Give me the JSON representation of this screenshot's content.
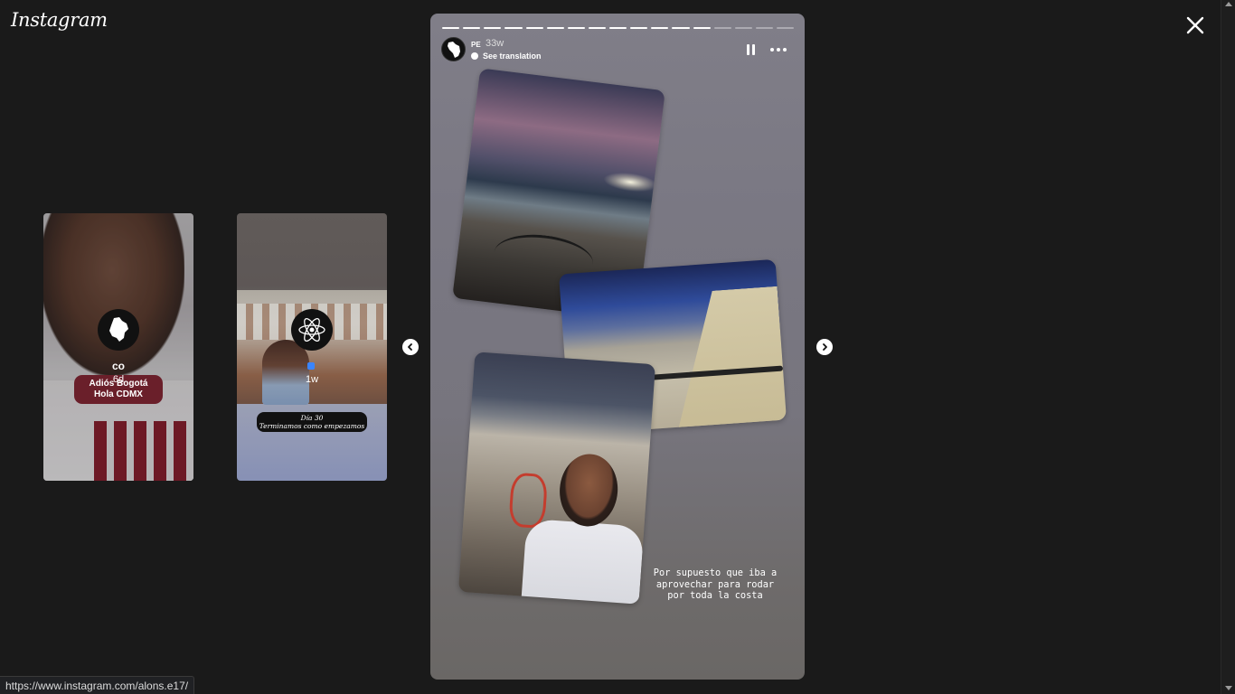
{
  "brand": {
    "logo_text": "Instagram"
  },
  "controls": {
    "close_icon": "close-icon",
    "prev_icon": "chevron-left-icon",
    "next_icon": "chevron-right-icon"
  },
  "previews": [
    {
      "user": "co",
      "time": "6d",
      "sticker_line1": "Adiós Bogotá",
      "sticker_line2": "Hola CDMX",
      "avatar_icon": "colombia-map-icon"
    },
    {
      "user": "",
      "time": "1w",
      "caption_line1": "Día 30",
      "caption_line2": "Terminamos como empezamos",
      "avatar_icon": "atom-icon"
    }
  ],
  "story": {
    "user": "PE",
    "time": "33w",
    "translate_label": "See translation",
    "avatar_icon": "peru-map-icon",
    "progress": {
      "total": 17,
      "completed": 13
    },
    "caption": "Por supuesto que iba a\naprovechar para rodar\npor toda la costa"
  },
  "status_bar": {
    "url": "https://www.instagram.com/alons.e17/"
  }
}
